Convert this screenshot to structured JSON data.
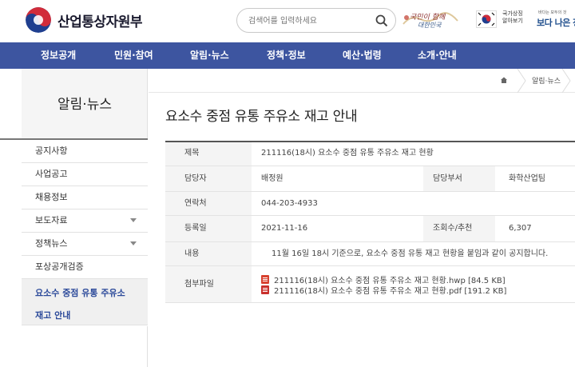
{
  "header": {
    "logo_text": "산업통상자원부",
    "search_placeholder": "검색어를 입력하세요",
    "slogan_line1": "국민이 함께",
    "slogan_line2": "대한민국",
    "flag_label": "국가상징 알아보기",
    "sea_small": "바다는 모두의 것",
    "sea_text": "보다 나은 정부"
  },
  "nav": {
    "items": [
      "정보공개",
      "민원·참여",
      "알림·뉴스",
      "정책·정보",
      "예산·법령",
      "소개·안내"
    ]
  },
  "sidebar": {
    "title": "알림·뉴스",
    "items": [
      {
        "label": "공지사항",
        "has_arrow": false
      },
      {
        "label": "사업공고",
        "has_arrow": false
      },
      {
        "label": "채용정보",
        "has_arrow": false
      },
      {
        "label": "보도자료",
        "has_arrow": true
      },
      {
        "label": "정책뉴스",
        "has_arrow": true
      },
      {
        "label": "포상공개검증",
        "has_arrow": false
      }
    ],
    "active_line1": "요소수 중점 유통 주유소",
    "active_line2": "재고 안내"
  },
  "breadcrumb": {
    "current": "알림·뉴스"
  },
  "page": {
    "title": "요소수 중점 유통 주유소 재고 안내"
  },
  "detail": {
    "title_label": "제목",
    "title_value": "211116(18시) 요소수 중점 유통 주유소 재고 현황",
    "manager_label": "담당자",
    "manager_value": "배정원",
    "dept_label": "담당부서",
    "dept_value": "화학산업팀",
    "contact_label": "연락처",
    "contact_value": "044-203-4933",
    "date_label": "등록일",
    "date_value": "2021-11-16",
    "views_label": "조회수/추천",
    "views_value": "6,307",
    "content_label": "내용",
    "content_value": "11월 16일 18시 기준으로, 요소수 중점 유통 재고 현황을 붙임과 같이 공지합니다.",
    "attach_label": "첨부파일",
    "files": [
      {
        "name": "211116(18시) 요소수 중점 유통 주유소 재고 현황.hwp [84.5 KB]",
        "type": "hwp"
      },
      {
        "name": "211116(18시) 요소수 중점 유통 주유소 재고 현황.pdf [191.2 KB]",
        "type": "pdf"
      }
    ]
  },
  "colors": {
    "nav_bg": "#3d55a0",
    "active_text": "#2c4a9a"
  }
}
